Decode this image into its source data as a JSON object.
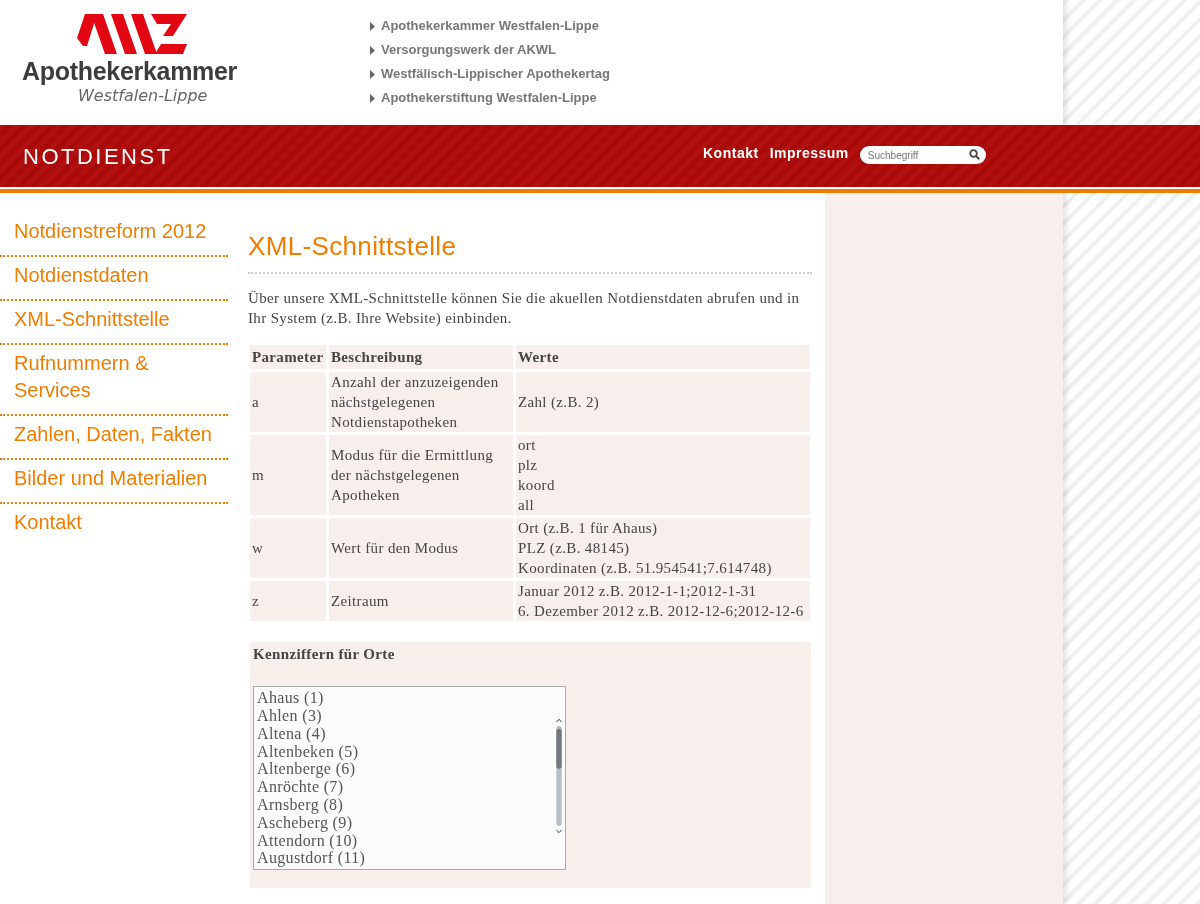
{
  "logo": {
    "name": "Apothekerkammer",
    "region": "Westfalen-Lippe"
  },
  "top_links": [
    "Apothekerkammer Westfalen-Lippe",
    "Versorgungswerk der AKWL",
    "Westfälisch-Lippischer Apothekertag",
    "Apothekerstiftung Westfalen-Lippe"
  ],
  "banner": {
    "title": "NOTDIENST",
    "links": [
      "Kontakt",
      "Impressum"
    ],
    "search": {
      "placeholder": "Suchbegriff"
    }
  },
  "sidebar": {
    "items": [
      "Notdienstreform 2012",
      "Notdienstdaten",
      "XML-Schnittstelle",
      "Rufnummern & Services",
      "Zahlen, Daten, Fakten",
      "Bilder und Materialien",
      "Kontakt"
    ]
  },
  "main": {
    "heading": "XML-Schnittstelle",
    "intro": "Über unsere XML-Schnittstelle können Sie die akuellen Notdienstdaten abrufen und in Ihr System (z.B. Ihre Website) einbinden.",
    "table": {
      "columns": [
        "Parameter",
        "Beschreibung",
        "Werte"
      ],
      "rows": [
        {
          "parameter": "a",
          "description": "Anzahl der anzuzeigenden nächstgelegenen Notdienstapotheken",
          "values": [
            "Zahl (z.B. 2)"
          ]
        },
        {
          "parameter": "m",
          "description": "Modus für die Ermittlung der nächstgelegenen Apotheken",
          "values": [
            "ort",
            "plz",
            "koord",
            "all"
          ]
        },
        {
          "parameter": "w",
          "description": "Wert für den Modus",
          "values": [
            "Ort (z.B. 1 für Ahaus)",
            "PLZ (z.B. 48145)",
            "Koordinaten (z.B. 51.954541;7.614748)"
          ]
        },
        {
          "parameter": "z",
          "description": "Zeitraum",
          "values": [
            "Januar 2012 z.B. 2012-1-1;2012-1-31",
            "6. Dezember 2012 z.B. 2012-12-6;2012-12-6"
          ]
        }
      ]
    },
    "codes": {
      "title": "Kennziffern für Orte",
      "options": [
        "Ahaus (1)",
        "Ahlen (3)",
        "Altena (4)",
        "Altenbeken (5)",
        "Altenberge (6)",
        "Anröchte (7)",
        "Arnsberg (8)",
        "Ascheberg (9)",
        "Attendorn (10)",
        "Augustdorf (11)"
      ]
    }
  }
}
